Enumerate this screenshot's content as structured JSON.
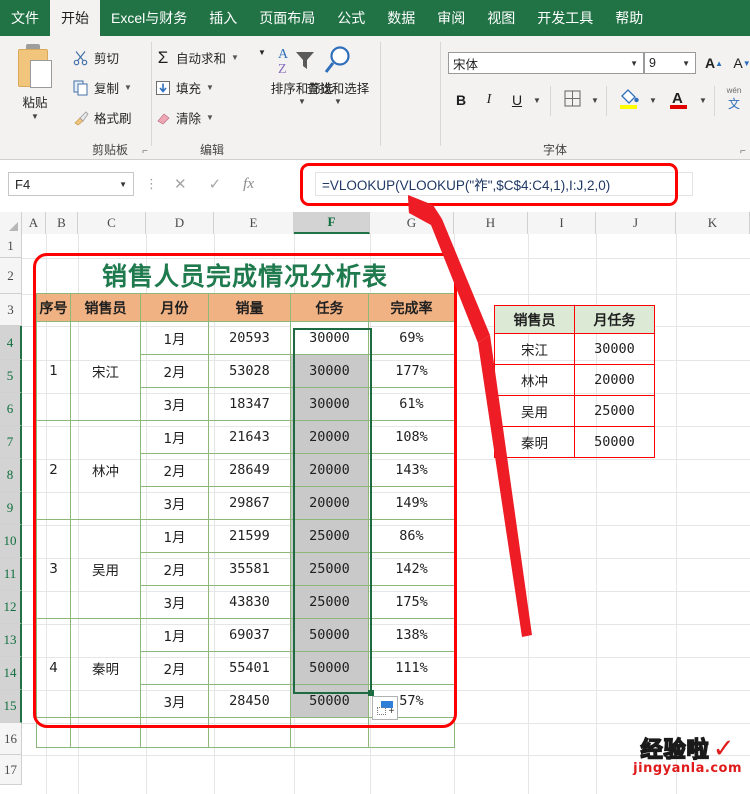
{
  "ribbon": {
    "tabs": [
      {
        "label": "文件",
        "active": false
      },
      {
        "label": "开始",
        "active": true
      },
      {
        "label": "Excel与财务",
        "active": false
      },
      {
        "label": "插入",
        "active": false
      },
      {
        "label": "页面布局",
        "active": false
      },
      {
        "label": "公式",
        "active": false
      },
      {
        "label": "数据",
        "active": false
      },
      {
        "label": "审阅",
        "active": false
      },
      {
        "label": "视图",
        "active": false
      },
      {
        "label": "开发工具",
        "active": false
      },
      {
        "label": "帮助",
        "active": false
      }
    ],
    "clipboard": {
      "paste_label": "粘贴",
      "group_label": "剪贴板",
      "cut_label": "剪切",
      "copy_label": "复制",
      "format_painter_label": "格式刷"
    },
    "editing": {
      "autosum_label": "自动求和",
      "fill_label": "填充",
      "clear_label": "清除",
      "sort_filter_label": "排序和筛选",
      "find_select_label": "查找和选择",
      "group_label": "编辑"
    },
    "font": {
      "font_name": "宋体",
      "font_size": "9",
      "bold_label": "B",
      "italic_label": "I",
      "underline_label": "U",
      "grow_font_label": "A",
      "shrink_font_label": "A",
      "phonetic_label_top": "wén",
      "phonetic_label_bottom": "文",
      "group_label": "字体"
    }
  },
  "formula_bar": {
    "name_box_value": "F4",
    "cancel_icon": "✕",
    "confirm_icon": "✓",
    "function_icon": "fx",
    "formula": "=VLOOKUP(VLOOKUP(\"祚\",$C$4:C4,1),I:J,2,0)"
  },
  "sheet": {
    "column_headers": [
      "A",
      "B",
      "C",
      "D",
      "E",
      "F",
      "G",
      "H",
      "I",
      "J",
      "K"
    ],
    "selected_column": "F",
    "row_headers": [
      "1",
      "2",
      "3",
      "4",
      "5",
      "6",
      "7",
      "8",
      "9",
      "10",
      "11",
      "12",
      "13",
      "14",
      "15",
      "16",
      "17"
    ],
    "selected_rows": [
      "4",
      "5",
      "6",
      "7",
      "8",
      "9",
      "10",
      "11",
      "12",
      "13",
      "14",
      "15"
    ]
  },
  "main_table": {
    "title": "销售人员完成情况分析表",
    "headers": [
      "序号",
      "销售员",
      "月份",
      "销量",
      "任务",
      "完成率"
    ],
    "rows": [
      {
        "no": "1",
        "name": "宋江",
        "month": "1月",
        "sales": "20593",
        "task": "30000",
        "rate": "69%"
      },
      {
        "no": "",
        "name": "",
        "month": "2月",
        "sales": "53028",
        "task": "30000",
        "rate": "177%"
      },
      {
        "no": "",
        "name": "",
        "month": "3月",
        "sales": "18347",
        "task": "30000",
        "rate": "61%"
      },
      {
        "no": "2",
        "name": "林冲",
        "month": "1月",
        "sales": "21643",
        "task": "20000",
        "rate": "108%"
      },
      {
        "no": "",
        "name": "",
        "month": "2月",
        "sales": "28649",
        "task": "20000",
        "rate": "143%"
      },
      {
        "no": "",
        "name": "",
        "month": "3月",
        "sales": "29867",
        "task": "20000",
        "rate": "149%"
      },
      {
        "no": "3",
        "name": "吴用",
        "month": "1月",
        "sales": "21599",
        "task": "25000",
        "rate": "86%"
      },
      {
        "no": "",
        "name": "",
        "month": "2月",
        "sales": "35581",
        "task": "25000",
        "rate": "142%"
      },
      {
        "no": "",
        "name": "",
        "month": "3月",
        "sales": "43830",
        "task": "25000",
        "rate": "175%"
      },
      {
        "no": "4",
        "name": "秦明",
        "month": "1月",
        "sales": "69037",
        "task": "50000",
        "rate": "138%"
      },
      {
        "no": "",
        "name": "",
        "month": "2月",
        "sales": "55401",
        "task": "50000",
        "rate": "111%"
      },
      {
        "no": "",
        "name": "",
        "month": "3月",
        "sales": "28450",
        "task": "50000",
        "rate": "57%"
      }
    ]
  },
  "lookup_table": {
    "headers": [
      "销售员",
      "月任务"
    ],
    "rows": [
      {
        "name": "宋江",
        "task": "30000"
      },
      {
        "name": "林冲",
        "task": "20000"
      },
      {
        "name": "吴用",
        "task": "25000"
      },
      {
        "name": "秦明",
        "task": "50000"
      }
    ]
  },
  "watermark": {
    "line1": "经验啦",
    "check": "✓",
    "line2": "jingyanla.com"
  },
  "colors": {
    "ribbon_green": "#217346",
    "highlight_red": "#ff0000",
    "header_orange": "#f0b183",
    "lookup_header_green": "#dce9d5",
    "title_green": "#1f7a4d",
    "selection_gray": "#c9c9c9"
  }
}
